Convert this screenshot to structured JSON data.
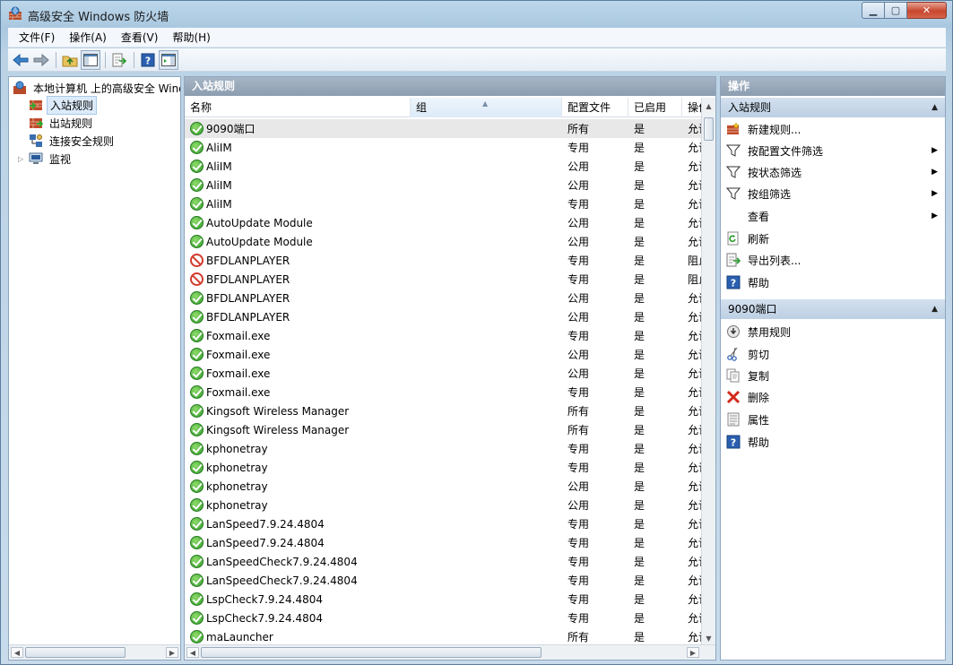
{
  "window": {
    "title": "高级安全 Windows 防火墙",
    "min": "▁",
    "max": "▢",
    "close": "✕"
  },
  "menu": [
    "文件(F)",
    "操作(A)",
    "查看(V)",
    "帮助(H)"
  ],
  "tree": {
    "root": "本地计算机 上的高级安全 Windows 防火墙",
    "items": [
      "入站规则",
      "出站规则",
      "连接安全规则",
      "监视"
    ]
  },
  "center": {
    "header": "入站规则",
    "columns": [
      "名称",
      "组",
      "配置文件",
      "已启用",
      "操作"
    ],
    "rows": [
      {
        "name": "9090端口",
        "group": "",
        "profile": "所有",
        "enabled": "是",
        "action": "允许",
        "status": "ok"
      },
      {
        "name": "AliIM",
        "group": "",
        "profile": "专用",
        "enabled": "是",
        "action": "允许",
        "status": "ok"
      },
      {
        "name": "AliIM",
        "group": "",
        "profile": "公用",
        "enabled": "是",
        "action": "允许",
        "status": "ok"
      },
      {
        "name": "AliIM",
        "group": "",
        "profile": "公用",
        "enabled": "是",
        "action": "允许",
        "status": "ok"
      },
      {
        "name": "AliIM",
        "group": "",
        "profile": "专用",
        "enabled": "是",
        "action": "允许",
        "status": "ok"
      },
      {
        "name": "AutoUpdate Module",
        "group": "",
        "profile": "公用",
        "enabled": "是",
        "action": "允许",
        "status": "ok"
      },
      {
        "name": "AutoUpdate Module",
        "group": "",
        "profile": "公用",
        "enabled": "是",
        "action": "允许",
        "status": "ok"
      },
      {
        "name": "BFDLANPLAYER",
        "group": "",
        "profile": "专用",
        "enabled": "是",
        "action": "阻止",
        "status": "block"
      },
      {
        "name": "BFDLANPLAYER",
        "group": "",
        "profile": "专用",
        "enabled": "是",
        "action": "阻止",
        "status": "block"
      },
      {
        "name": "BFDLANPLAYER",
        "group": "",
        "profile": "公用",
        "enabled": "是",
        "action": "允许",
        "status": "ok"
      },
      {
        "name": "BFDLANPLAYER",
        "group": "",
        "profile": "公用",
        "enabled": "是",
        "action": "允许",
        "status": "ok"
      },
      {
        "name": "Foxmail.exe",
        "group": "",
        "profile": "专用",
        "enabled": "是",
        "action": "允许",
        "status": "ok"
      },
      {
        "name": "Foxmail.exe",
        "group": "",
        "profile": "公用",
        "enabled": "是",
        "action": "允许",
        "status": "ok"
      },
      {
        "name": "Foxmail.exe",
        "group": "",
        "profile": "公用",
        "enabled": "是",
        "action": "允许",
        "status": "ok"
      },
      {
        "name": "Foxmail.exe",
        "group": "",
        "profile": "专用",
        "enabled": "是",
        "action": "允许",
        "status": "ok"
      },
      {
        "name": "Kingsoft Wireless Manager",
        "group": "",
        "profile": "所有",
        "enabled": "是",
        "action": "允许",
        "status": "ok"
      },
      {
        "name": "Kingsoft Wireless Manager",
        "group": "",
        "profile": "所有",
        "enabled": "是",
        "action": "允许",
        "status": "ok"
      },
      {
        "name": "kphonetray",
        "group": "",
        "profile": "专用",
        "enabled": "是",
        "action": "允许",
        "status": "ok"
      },
      {
        "name": "kphonetray",
        "group": "",
        "profile": "专用",
        "enabled": "是",
        "action": "允许",
        "status": "ok"
      },
      {
        "name": "kphonetray",
        "group": "",
        "profile": "公用",
        "enabled": "是",
        "action": "允许",
        "status": "ok"
      },
      {
        "name": "kphonetray",
        "group": "",
        "profile": "公用",
        "enabled": "是",
        "action": "允许",
        "status": "ok"
      },
      {
        "name": "LanSpeed7.9.24.4804",
        "group": "",
        "profile": "专用",
        "enabled": "是",
        "action": "允许",
        "status": "ok"
      },
      {
        "name": "LanSpeed7.9.24.4804",
        "group": "",
        "profile": "专用",
        "enabled": "是",
        "action": "允许",
        "status": "ok"
      },
      {
        "name": "LanSpeedCheck7.9.24.4804",
        "group": "",
        "profile": "专用",
        "enabled": "是",
        "action": "允许",
        "status": "ok"
      },
      {
        "name": "LanSpeedCheck7.9.24.4804",
        "group": "",
        "profile": "专用",
        "enabled": "是",
        "action": "允许",
        "status": "ok"
      },
      {
        "name": "LspCheck7.9.24.4804",
        "group": "",
        "profile": "专用",
        "enabled": "是",
        "action": "允许",
        "status": "ok"
      },
      {
        "name": "LspCheck7.9.24.4804",
        "group": "",
        "profile": "专用",
        "enabled": "是",
        "action": "允许",
        "status": "ok"
      },
      {
        "name": "maLauncher",
        "group": "",
        "profile": "所有",
        "enabled": "是",
        "action": "允许",
        "status": "ok"
      }
    ]
  },
  "actions": {
    "header": "操作",
    "group1": {
      "title": "入站规则",
      "items": [
        "新建规则...",
        "按配置文件筛选",
        "按状态筛选",
        "按组筛选",
        "查看",
        "刷新",
        "导出列表...",
        "帮助"
      ]
    },
    "group2": {
      "title": "9090端口",
      "items": [
        "禁用规则",
        "剪切",
        "复制",
        "删除",
        "属性",
        "帮助"
      ]
    }
  },
  "colors": {
    "ok": "#2f9a2a",
    "block": "#d23b2c",
    "pane_header": "#8c9db0",
    "selection": "#dcebfb"
  }
}
